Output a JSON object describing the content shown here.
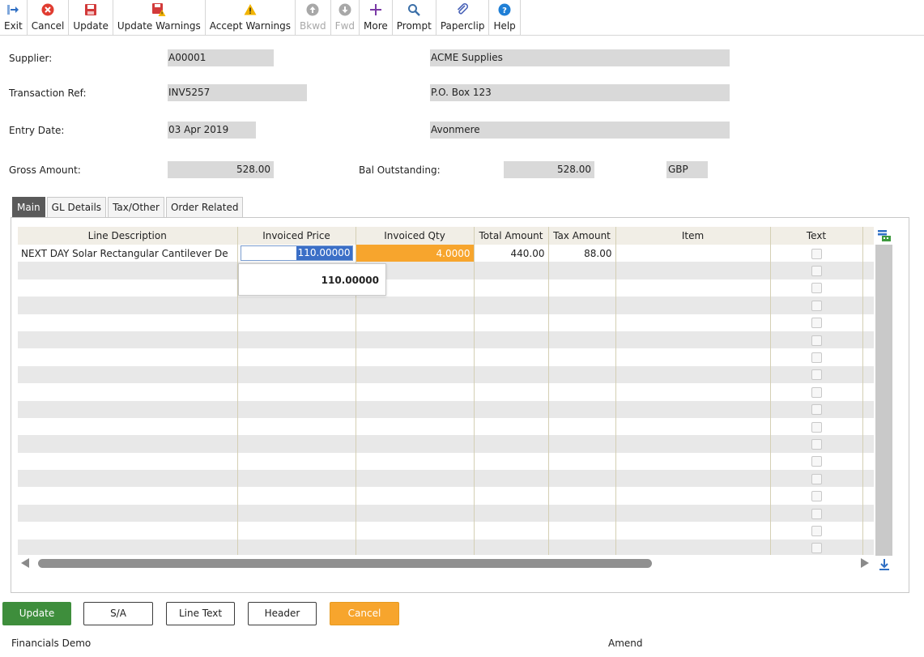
{
  "toolbar": {
    "exit": "Exit",
    "cancel": "Cancel",
    "update": "Update",
    "update_warnings": "Update Warnings",
    "accept_warnings": "Accept Warnings",
    "bkwd": "Bkwd",
    "fwd": "Fwd",
    "more": "More",
    "prompt": "Prompt",
    "paperclip": "Paperclip",
    "help": "Help"
  },
  "form": {
    "supplier_label": "Supplier:",
    "supplier_code": "A00001",
    "supplier_name": "ACME Supplies",
    "transaction_ref_label": "Transaction Ref:",
    "transaction_ref": "INV5257",
    "address_line1": "P.O. Box 123",
    "entry_date_label": "Entry Date:",
    "entry_date": "03 Apr 2019",
    "address_line2": "Avonmere",
    "gross_amount_label": "Gross Amount:",
    "gross_amount": "528.00",
    "bal_outstanding_label": "Bal Outstanding:",
    "bal_outstanding": "528.00",
    "currency": "GBP"
  },
  "tabs": [
    {
      "label": "Main",
      "active": true
    },
    {
      "label": "GL Details",
      "active": false
    },
    {
      "label": "Tax/Other",
      "active": false
    },
    {
      "label": "Order Related",
      "active": false
    }
  ],
  "grid": {
    "columns": [
      "Line Description",
      "Invoiced Price",
      "Invoiced Qty",
      "Total Amount",
      "Tax Amount",
      "Item",
      "Text"
    ],
    "rows": [
      {
        "line_description": "NEXT DAY Solar Rectangular Cantilever De",
        "invoiced_price": "110.00000",
        "invoiced_qty": "4.0000",
        "total_amount": "440.00",
        "tax_amount": "88.00",
        "item": "",
        "text_checked": false
      }
    ],
    "empty_row_count": 17,
    "price_tooltip": "110.00000"
  },
  "buttons": {
    "update": "Update",
    "sa": "S/A",
    "line_text": "Line Text",
    "header": "Header",
    "cancel": "Cancel"
  },
  "status": {
    "company": "Financials Demo",
    "mode": "Amend"
  },
  "colors": {
    "update_button": "#3e8e3c",
    "cancel_button": "#f7a52d",
    "active_tab": "#5a5a5a",
    "qty_highlight": "#f7a52d",
    "price_selection": "#3b6fc7"
  },
  "icons": {
    "exit": "exit-arrow-icon",
    "cancel": "cancel-circle-icon",
    "update": "save-disk-icon",
    "update_warnings": "save-warning-icon",
    "accept_warnings": "warning-triangle-icon",
    "bkwd": "arrow-up-circle-icon",
    "fwd": "arrow-down-circle-icon",
    "more": "plus-icon",
    "prompt": "magnifier-icon",
    "paperclip": "paperclip-icon",
    "help": "help-circle-icon"
  }
}
